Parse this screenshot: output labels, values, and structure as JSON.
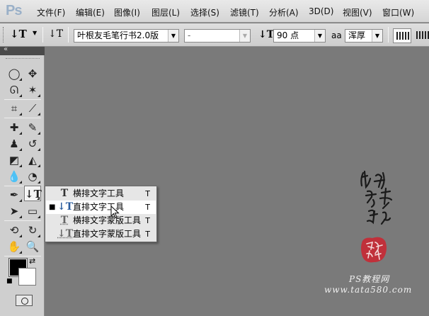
{
  "app": {
    "logo": "Ps"
  },
  "menu": [
    "文件(F)",
    "编辑(E)",
    "图像(I)",
    "图层(L)",
    "选择(S)",
    "滤镜(T)",
    "分析(A)",
    "3D(D)",
    "视图(V)",
    "窗口(W)"
  ],
  "options": {
    "font_family": "叶根友毛笔行书2.0版",
    "font_style": "-",
    "font_size": "90 点",
    "anti_alias": "浑厚"
  },
  "flyout": {
    "items": [
      {
        "label": "横排文字工具",
        "shortcut": "T",
        "selected": false,
        "icon": "horizontal-type-icon"
      },
      {
        "label": "直排文字工具",
        "shortcut": "T",
        "selected": true,
        "icon": "vertical-type-icon"
      },
      {
        "label": "横排文字蒙版工具",
        "shortcut": "T",
        "selected": false,
        "icon": "horizontal-type-mask-icon"
      },
      {
        "label": "直排文字蒙版工具",
        "shortcut": "T",
        "selected": false,
        "icon": "vertical-type-mask-icon"
      }
    ]
  },
  "colors": {
    "foreground": "#000000",
    "background": "#ffffff",
    "canvas": "#7a7a7a",
    "seal": "#c0303a"
  },
  "watermark": {
    "site": "PS教程网",
    "url": "www.tata580.com"
  }
}
